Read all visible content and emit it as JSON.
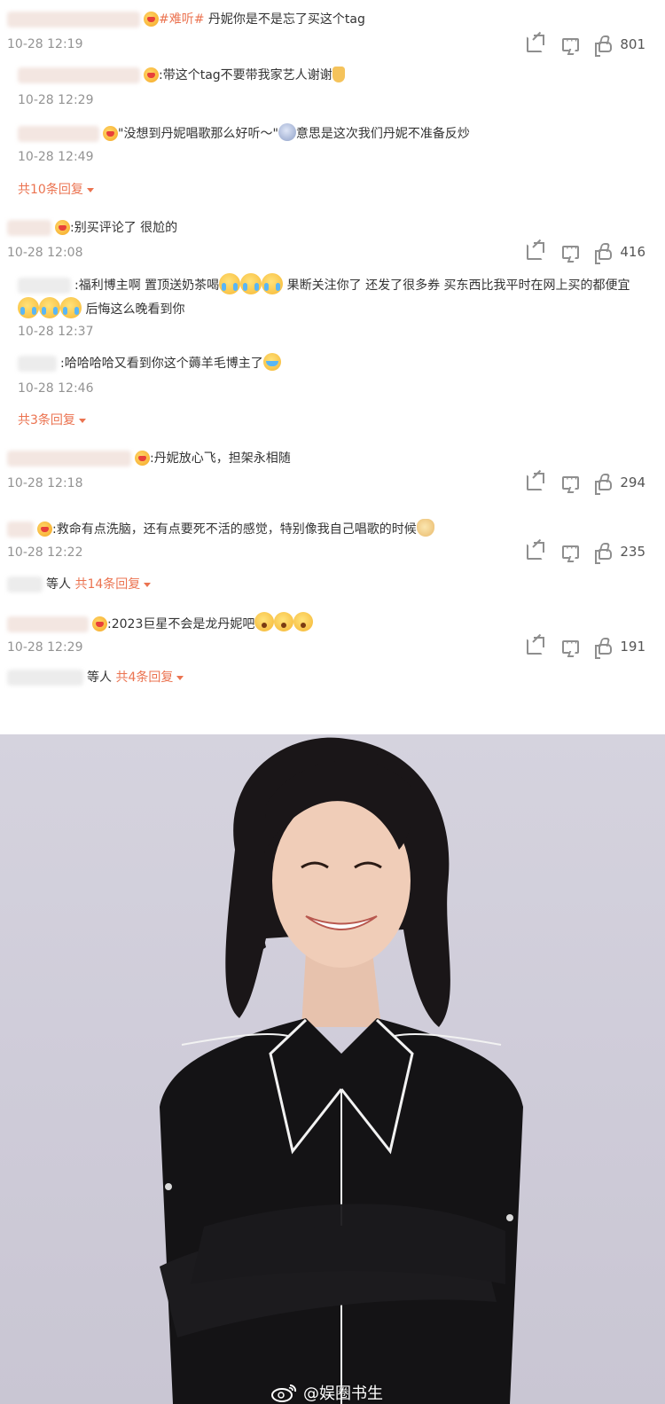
{
  "comments": [
    {
      "text_tag": "#难听#",
      "text": " 丹妮你是不是忘了买这个tag",
      "time": "10-28 12:19",
      "likes": "801",
      "replies": [
        {
          "text": ":带这个tag不要带我家艺人谢谢",
          "time": "10-28 12:29"
        },
        {
          "text": "\"没想到丹妮唱歌那么好听～\"",
          "text2": "意思是这次我们丹妮不准备反炒",
          "time": "10-28 12:49"
        }
      ],
      "more": "共10条回复"
    },
    {
      "text": ":别买评论了 很尬的",
      "time": "10-28 12:08",
      "likes": "416",
      "replies": [
        {
          "text": ":福利博主啊 置顶送奶茶喝",
          "text2": " 果断关注你了 还发了很多券 买东西比我平时在网上买的都便宜",
          "text3": " 后悔这么晚看到你",
          "time": "10-28 12:37"
        },
        {
          "text": ":哈哈哈哈又看到你这个薅羊毛博主了",
          "time": "10-28 12:46"
        }
      ],
      "more": "共3条回复"
    },
    {
      "text": ":丹妮放心飞，担架永相随",
      "time": "10-28 12:18",
      "likes": "294"
    },
    {
      "text": ":救命有点洗脑，还有点要死不活的感觉，特别像我自己唱歌的时候",
      "time": "10-28 12:22",
      "likes": "235",
      "summary_prefix": "等人",
      "more": "共14条回复"
    },
    {
      "text": ":2023巨星不会是龙丹妮吧",
      "time": "10-28 12:29",
      "likes": "191",
      "summary_prefix": "等人",
      "more": "共4条回复"
    }
  ],
  "watermark": {
    "text": "@娱圈书生",
    "icon": "weibo-logo-icon"
  },
  "colors": {
    "accent": "#eb7350",
    "time": "#939393",
    "text": "#333333",
    "icon": "#8e8e8e",
    "photo_bg": "#d1cedb"
  }
}
